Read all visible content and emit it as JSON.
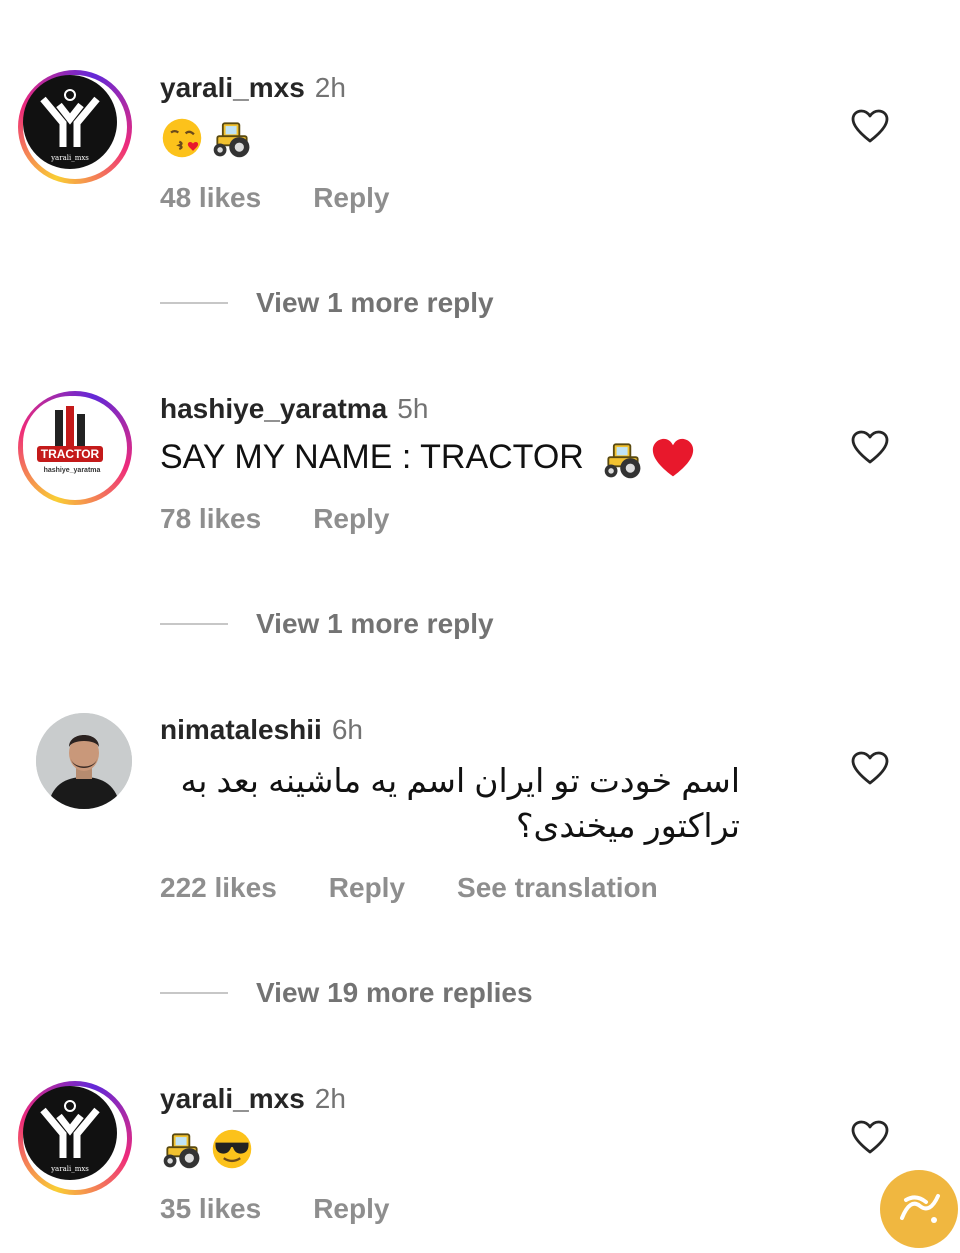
{
  "comments": [
    {
      "username": "yarali_mxs",
      "time": "2h",
      "text": "",
      "emojis": [
        "kissing-face-emoji",
        "tractor-emoji"
      ],
      "likes": "48 likes",
      "reply": "Reply",
      "view_more": "View 1 more reply",
      "avatar_caption": "yarali_mxs"
    },
    {
      "username": "hashiye_yaratma",
      "time": "5h",
      "text": "SAY MY NAME : TRACTOR",
      "emojis": [
        "tractor-emoji",
        "red-heart-emoji"
      ],
      "likes": "78 likes",
      "reply": "Reply",
      "view_more": "View 1 more reply",
      "avatar_brand": "TRACTOR",
      "avatar_caption": "hashiye_yaratma"
    },
    {
      "username": "nimataleshii",
      "time": "6h",
      "text_line1": "اسم خودت تو ایران اسم یه ماشینه بعد به",
      "text_line2": "تراکتور میخندی؟",
      "likes": "222 likes",
      "reply": "Reply",
      "translate": "See translation",
      "view_more": "View 19 more replies"
    },
    {
      "username": "yarali_mxs",
      "time": "2h",
      "text": "",
      "emojis": [
        "tractor-emoji",
        "sunglasses-face-emoji"
      ],
      "likes": "35 likes",
      "reply": "Reply",
      "avatar_caption": "yarali_mxs"
    }
  ],
  "colors": {
    "text": "#262626",
    "secondary": "#8e8e8e",
    "divider": "#c7c7c7",
    "watermark": "#f0b740"
  }
}
